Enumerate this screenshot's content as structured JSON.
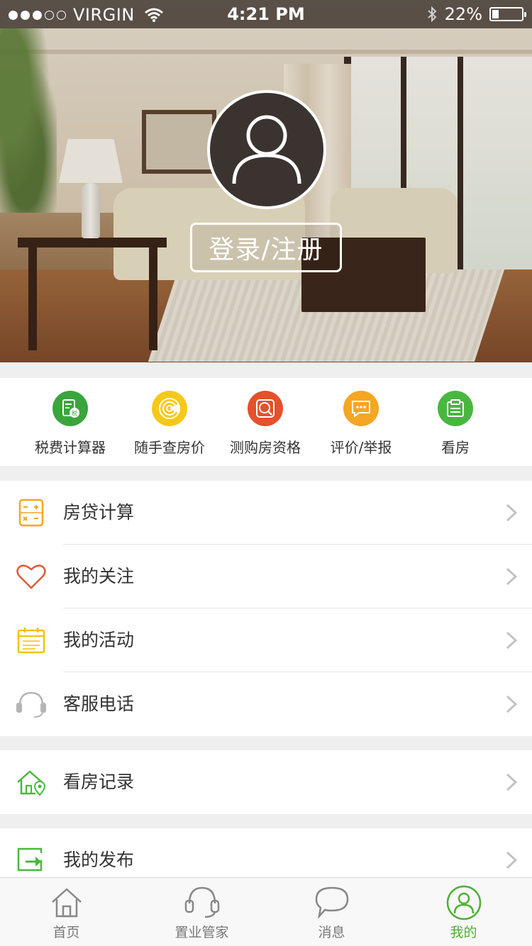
{
  "status_bar": {
    "carrier": "VIRGIN",
    "time": "4:21 PM",
    "battery": "22%",
    "battery_level": 0.22,
    "signal_bars_filled": 3,
    "signal_bars_total": 5
  },
  "profile": {
    "login_label": "登录/注册"
  },
  "tools": [
    {
      "label": "税费计算器",
      "icon": "tax-calculator-icon",
      "color": "#3aa53c"
    },
    {
      "label": "随手查房价",
      "icon": "radar-icon",
      "color": "#f6c81a"
    },
    {
      "label": "测购房资格",
      "icon": "qualification-check-icon",
      "color": "#e4512a"
    },
    {
      "label": "评价/举报",
      "icon": "comment-icon",
      "color": "#f5a623"
    },
    {
      "label": "看房",
      "icon": "view-house-icon",
      "color": "#49b73f"
    }
  ],
  "menu_group_1": [
    {
      "label": "房贷计算",
      "icon": "mortgage-calculator-icon",
      "color": "#f5a623"
    },
    {
      "label": "我的关注",
      "icon": "heart-icon",
      "color": "#e05a3a"
    },
    {
      "label": "我的活动",
      "icon": "calendar-icon",
      "color": "#f2c200"
    },
    {
      "label": "客服电话",
      "icon": "headset-icon",
      "color": "#b5b5b5"
    }
  ],
  "menu_group_2": [
    {
      "label": "看房记录",
      "icon": "house-location-icon",
      "color": "#49b73f"
    }
  ],
  "menu_group_3": [
    {
      "label": "我的发布",
      "icon": "publish-icon",
      "color": "#49b73f"
    }
  ],
  "tabbar": [
    {
      "label": "首页",
      "icon": "home-icon",
      "active": false
    },
    {
      "label": "置业管家",
      "icon": "headset-icon",
      "active": false
    },
    {
      "label": "消息",
      "icon": "message-icon",
      "active": false
    },
    {
      "label": "我的",
      "icon": "profile-icon",
      "active": true
    }
  ],
  "colors": {
    "accent": "#4cb033",
    "background": "#efefef"
  }
}
